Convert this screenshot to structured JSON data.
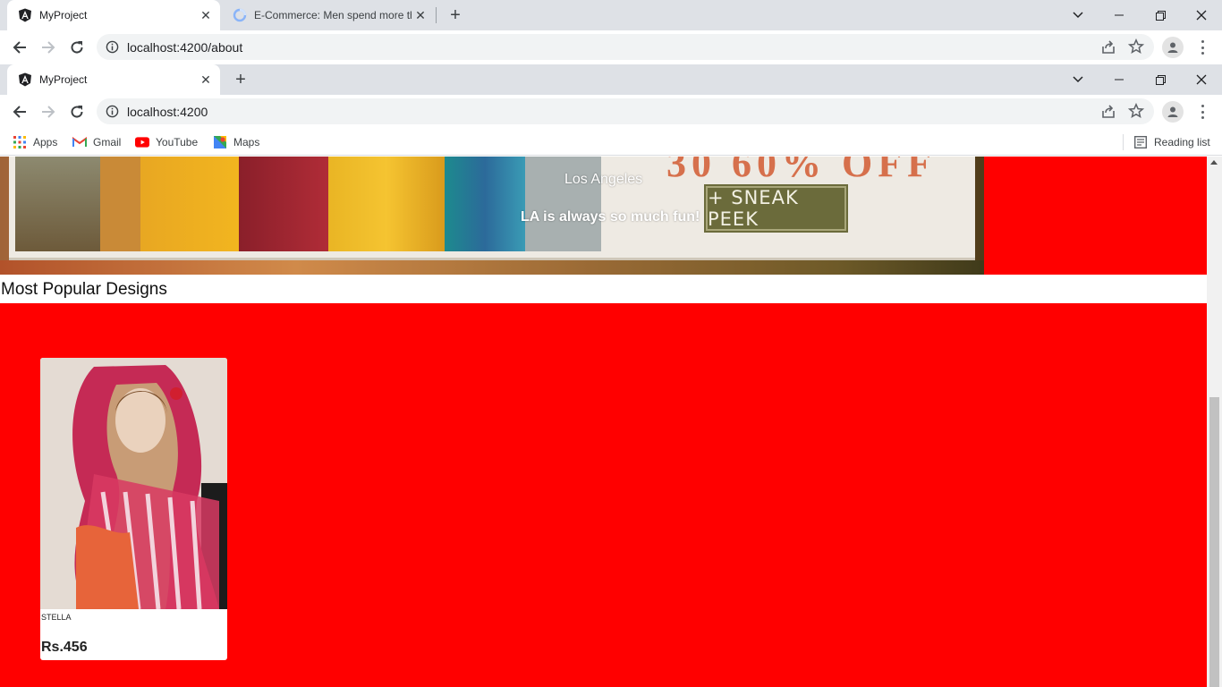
{
  "browser_outer": {
    "tabs": [
      {
        "title": "MyProject",
        "active": true,
        "icon": "angular-icon"
      },
      {
        "title": "E-Commerce: Men spend more th",
        "active": false,
        "icon": "loading-ring-icon"
      }
    ],
    "url": "localhost:4200/about"
  },
  "browser_inner": {
    "tabs": [
      {
        "title": "MyProject",
        "active": true,
        "icon": "angular-icon"
      }
    ],
    "url": "localhost:4200",
    "bookmarks": [
      {
        "label": "Apps",
        "icon": "apps-grid-icon"
      },
      {
        "label": "Gmail",
        "icon": "gmail-icon"
      },
      {
        "label": "YouTube",
        "icon": "youtube-icon"
      },
      {
        "label": "Maps",
        "icon": "maps-icon"
      }
    ],
    "reading_list": "Reading list"
  },
  "page": {
    "hero": {
      "caption_title": "Los Angeles",
      "caption_text": "LA is always so much fun!",
      "banner_button": "+ SNEAK PEEK",
      "banner_headline_fragment": "30 60% OFF"
    },
    "section_title": "Most Popular Designs",
    "products": [
      {
        "name": "STELLA",
        "price": "Rs.456"
      }
    ]
  },
  "colors": {
    "page_accent": "#ff0000",
    "chrome_tabbar": "#dee1e6",
    "omnibox": "#f1f3f4",
    "sneak_button": "#6b6b3b"
  }
}
